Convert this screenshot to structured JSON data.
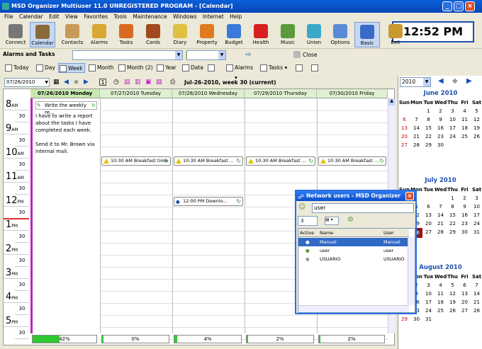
{
  "window": {
    "title": "MSD Organizer Multiuser 11.0 UNREGISTERED PROGRAM - [Calendar]"
  },
  "menu": [
    "File",
    "Calendar",
    "Edit",
    "View",
    "Favorites",
    "Tools",
    "Maintenance",
    "Windows",
    "Internet",
    "Help"
  ],
  "clock": "12:52 PM",
  "toolbar": [
    {
      "label": "Connect",
      "icon": "connect-icon",
      "color": "#777777"
    },
    {
      "label": "Calendar",
      "icon": "calendar-icon",
      "color": "#8a6a3a"
    },
    {
      "label": "Contacts",
      "icon": "contacts-icon",
      "color": "#c89a5a"
    },
    {
      "label": "Alarms",
      "icon": "alarm-clock-icon",
      "color": "#d8a830"
    },
    {
      "label": "Tasks",
      "icon": "tasks-icon",
      "color": "#d86a20"
    },
    {
      "label": "Cards",
      "icon": "cards-icon",
      "color": "#a04a20"
    },
    {
      "label": "Diary",
      "icon": "diary-icon",
      "color": "#e0c040"
    },
    {
      "label": "Property",
      "icon": "house-icon",
      "color": "#e07a20"
    },
    {
      "label": "Budget",
      "icon": "budget-icon",
      "color": "#3a7ad8"
    },
    {
      "label": "Health",
      "icon": "health-cross-icon",
      "color": "#d82020"
    },
    {
      "label": "Music",
      "icon": "music-cd-icon",
      "color": "#5a9a3a"
    },
    {
      "label": "Union",
      "icon": "union-icon",
      "color": "#3aa8c8"
    },
    {
      "label": "Options",
      "icon": "options-icon",
      "color": "#5a8ad8"
    },
    {
      "label": "Basic",
      "icon": "basic-icon",
      "color": "#3a6ac8"
    },
    {
      "label": "Exit",
      "icon": "exit-icon",
      "color": "#c89a30"
    }
  ],
  "row2": {
    "combo1": "Alarms and Tasks",
    "close": "Close"
  },
  "views": [
    "Today",
    "Day",
    "Week",
    "Month",
    "Month (2)",
    "Year",
    "Data",
    "Alarms",
    "Tasks"
  ],
  "nav": {
    "date": "07/26/2010",
    "week_label": "Jul-26-2010, week 30 (current)"
  },
  "days": [
    "07/26/2010 Monday",
    "07/27/2010 Tuesday",
    "07/28/2010 Wednesday",
    "07/29/2010 Thursday",
    "07/30/2010 Friday"
  ],
  "hours": [
    {
      "h": "8",
      "ap": "AM"
    },
    {
      "h": "9",
      "ap": "AM"
    },
    {
      "h": "10",
      "ap": "AM"
    },
    {
      "h": "11",
      "ap": "AM"
    },
    {
      "h": "12",
      "ap": "PM"
    },
    {
      "h": "1",
      "ap": "PM"
    },
    {
      "h": "2",
      "ap": "PM"
    },
    {
      "h": "3",
      "ap": "PM"
    },
    {
      "h": "4",
      "ap": "PM"
    },
    {
      "h": "5",
      "ap": "PM"
    }
  ],
  "half": "30",
  "task": {
    "title": "Write the weekly re...",
    "body": "I have to write a report about the tasks I have completed each week.",
    "body2": "Send it to Mr. Brown via internal mail."
  },
  "events": [
    "10:30 AM Breakfast time",
    "10:30 AM Breakfast ...",
    "10:30 AM Breakfast ...",
    "10:30 AM Breakfast ...",
    "12:00 PM Downlo..."
  ],
  "progress": [
    {
      "label": "42%",
      "value": 0.42
    },
    {
      "label": "0%",
      "value": 0.0
    },
    {
      "label": "4%",
      "value": 0.04
    },
    {
      "label": "2%",
      "value": 0.02
    },
    {
      "label": "2%",
      "value": 0.02
    }
  ],
  "minical": {
    "year": "2010",
    "dow": [
      "Sun",
      "Mon",
      "Tue",
      "Wed",
      "Thu",
      "Fri",
      "Sat"
    ],
    "months": [
      {
        "name": "June 2010",
        "weeks": [
          [
            "",
            "",
            "1",
            "2",
            "3",
            "4",
            "5"
          ],
          [
            "6",
            "7",
            "8",
            "9",
            "10",
            "11",
            "12"
          ],
          [
            "13",
            "14",
            "15",
            "16",
            "17",
            "18",
            "19"
          ],
          [
            "20",
            "21",
            "22",
            "23",
            "24",
            "25",
            "26"
          ],
          [
            "27",
            "28",
            "29",
            "30",
            "",
            "",
            ""
          ]
        ]
      },
      {
        "name": "July 2010",
        "weeks": [
          [
            "",
            "",
            "",
            "",
            "1",
            "2",
            "3"
          ],
          [
            "4",
            "5",
            "6",
            "7",
            "8",
            "9",
            "10"
          ],
          [
            "11",
            "12",
            "13",
            "14",
            "15",
            "16",
            "17"
          ],
          [
            "18",
            "19",
            "20",
            "21",
            "22",
            "23",
            "24"
          ],
          [
            "25",
            "26",
            "27",
            "28",
            "29",
            "30",
            "31"
          ]
        ]
      },
      {
        "name": "August 2010",
        "weeks": [
          [
            "1",
            "2",
            "3",
            "4",
            "5",
            "6",
            "7"
          ],
          [
            "8",
            "9",
            "10",
            "11",
            "12",
            "13",
            "14"
          ],
          [
            "15",
            "16",
            "17",
            "18",
            "19",
            "20",
            "21"
          ],
          [
            "22",
            "23",
            "24",
            "25",
            "26",
            "27",
            "28"
          ],
          [
            "29",
            "30",
            "31",
            "",
            "",
            "",
            ""
          ]
        ]
      }
    ]
  },
  "network": {
    "title": "Network users - MSD Organizer",
    "search": "user",
    "count": "3",
    "headers": [
      "Active",
      "Name",
      "User"
    ],
    "rows": [
      [
        "Manuel",
        "Manuel"
      ],
      [
        "user",
        "user"
      ],
      [
        "USUARIO",
        "USUARIO"
      ]
    ]
  }
}
